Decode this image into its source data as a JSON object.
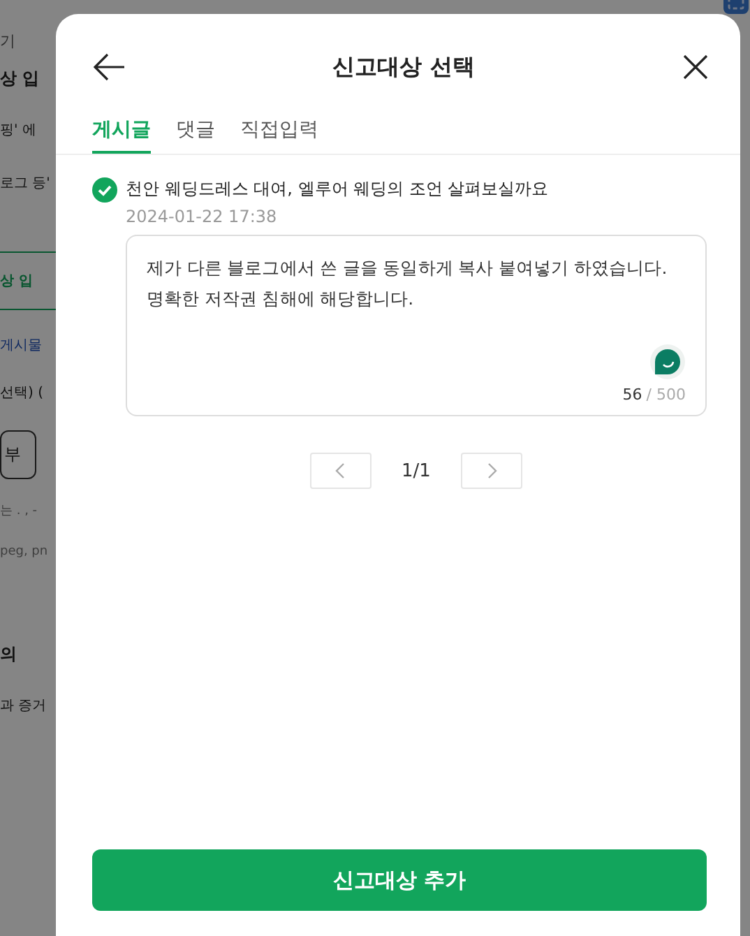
{
  "background": {
    "items": [
      {
        "kind": "small",
        "text": "기"
      },
      {
        "kind": "heading",
        "text": "상 입"
      },
      {
        "kind": "text",
        "text": "핑' 에"
      },
      {
        "kind": "text",
        "text": "로그 등'"
      },
      {
        "kind": "tab",
        "text": "상 입"
      },
      {
        "kind": "link",
        "text": "게시물"
      },
      {
        "kind": "text",
        "text": "선택) ("
      },
      {
        "kind": "button",
        "text": "부"
      },
      {
        "kind": "hint",
        "text": "는 . , -"
      },
      {
        "kind": "hint",
        "text": "peg, pn"
      },
      {
        "kind": "heading",
        "text": "의"
      },
      {
        "kind": "text",
        "text": "과 증거"
      }
    ]
  },
  "modal": {
    "title": "신고대상 선택",
    "tabs": [
      {
        "label": "게시글",
        "selected": true
      },
      {
        "label": "댓글",
        "selected": false
      },
      {
        "label": "직접입력",
        "selected": false
      }
    ],
    "post": {
      "checked": true,
      "title": "천안 웨딩드레스 대여, 엘루어 웨딩의 조언 살펴보실까요",
      "date": "2024-01-22 17:38"
    },
    "reason": {
      "value": "제가 다른 블로그에서 쓴 글을 동일하게 복사 붙여넣기 하였습니다. 명확한 저작권 침해에 해당합니다.",
      "count": "56",
      "limit": "/ 500"
    },
    "pagination": {
      "page": "1/1"
    },
    "submit": "신고대상 추가"
  }
}
